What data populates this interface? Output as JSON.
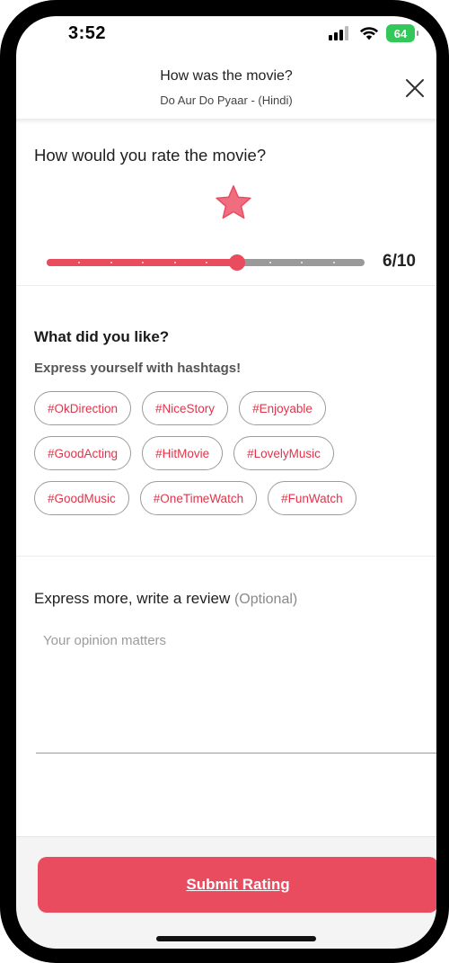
{
  "status_bar": {
    "time": "3:52",
    "battery": "64"
  },
  "header": {
    "title": "How was the movie?",
    "subtitle": "Do Aur Do Pyaar - (Hindi)",
    "close_icon": "close-icon"
  },
  "rating": {
    "question": "How would you rate the movie?",
    "value": 6,
    "max": 10,
    "display": "6/10",
    "accent_color": "#e94b5f"
  },
  "likes": {
    "title": "What did you like?",
    "subtitle": "Express yourself with hashtags!",
    "tag_rows": [
      [
        "#OkDirection",
        "#NiceStory",
        "#Enjoyable"
      ],
      [
        "#GoodActing",
        "#HitMovie",
        "#LovelyMusic"
      ],
      [
        "#GoodMusic",
        "#OneTimeWatch",
        "#FunWatch"
      ]
    ]
  },
  "review": {
    "title": "Express more, write a review",
    "optional": "(Optional)",
    "placeholder": "Your opinion matters",
    "value": ""
  },
  "footer": {
    "submit_label": "Submit Rating"
  }
}
